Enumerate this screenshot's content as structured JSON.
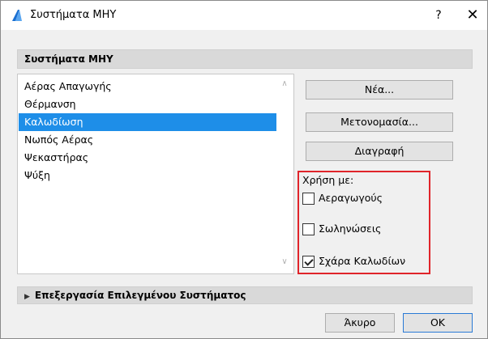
{
  "window": {
    "title": "Συστήματα ΜΗΥ",
    "help_label": "?",
    "close_label": "✕"
  },
  "section": {
    "title": "Συστήματα ΜΗΥ"
  },
  "systems_list": {
    "items": [
      "Αέρας Απαγωγής",
      "Θέρμανση",
      "Καλωδίωση",
      "Νωπός Αέρας",
      "Ψεκαστήρας",
      "Ψύξη"
    ],
    "selected": "Καλωδίωση"
  },
  "actions": {
    "new_label": "Νέα...",
    "rename_label": "Μετονομασία...",
    "delete_label": "Διαγραφή"
  },
  "usage": {
    "label": "Χρήση με:",
    "options": [
      {
        "label": "Αεραγωγούς",
        "checked": false
      },
      {
        "label": "Σωληνώσεις",
        "checked": false
      },
      {
        "label": "Σχάρα Καλωδίων",
        "checked": true
      }
    ],
    "highlight_color": "#e0242a"
  },
  "edit_section": {
    "title": "Επεξεργασία Επιλεγμένου Συστήματος"
  },
  "footer": {
    "cancel_label": "Άκυρο",
    "ok_label": "OK"
  },
  "colors": {
    "selection": "#1e8ee8",
    "header_bg": "#d9d9d9"
  }
}
